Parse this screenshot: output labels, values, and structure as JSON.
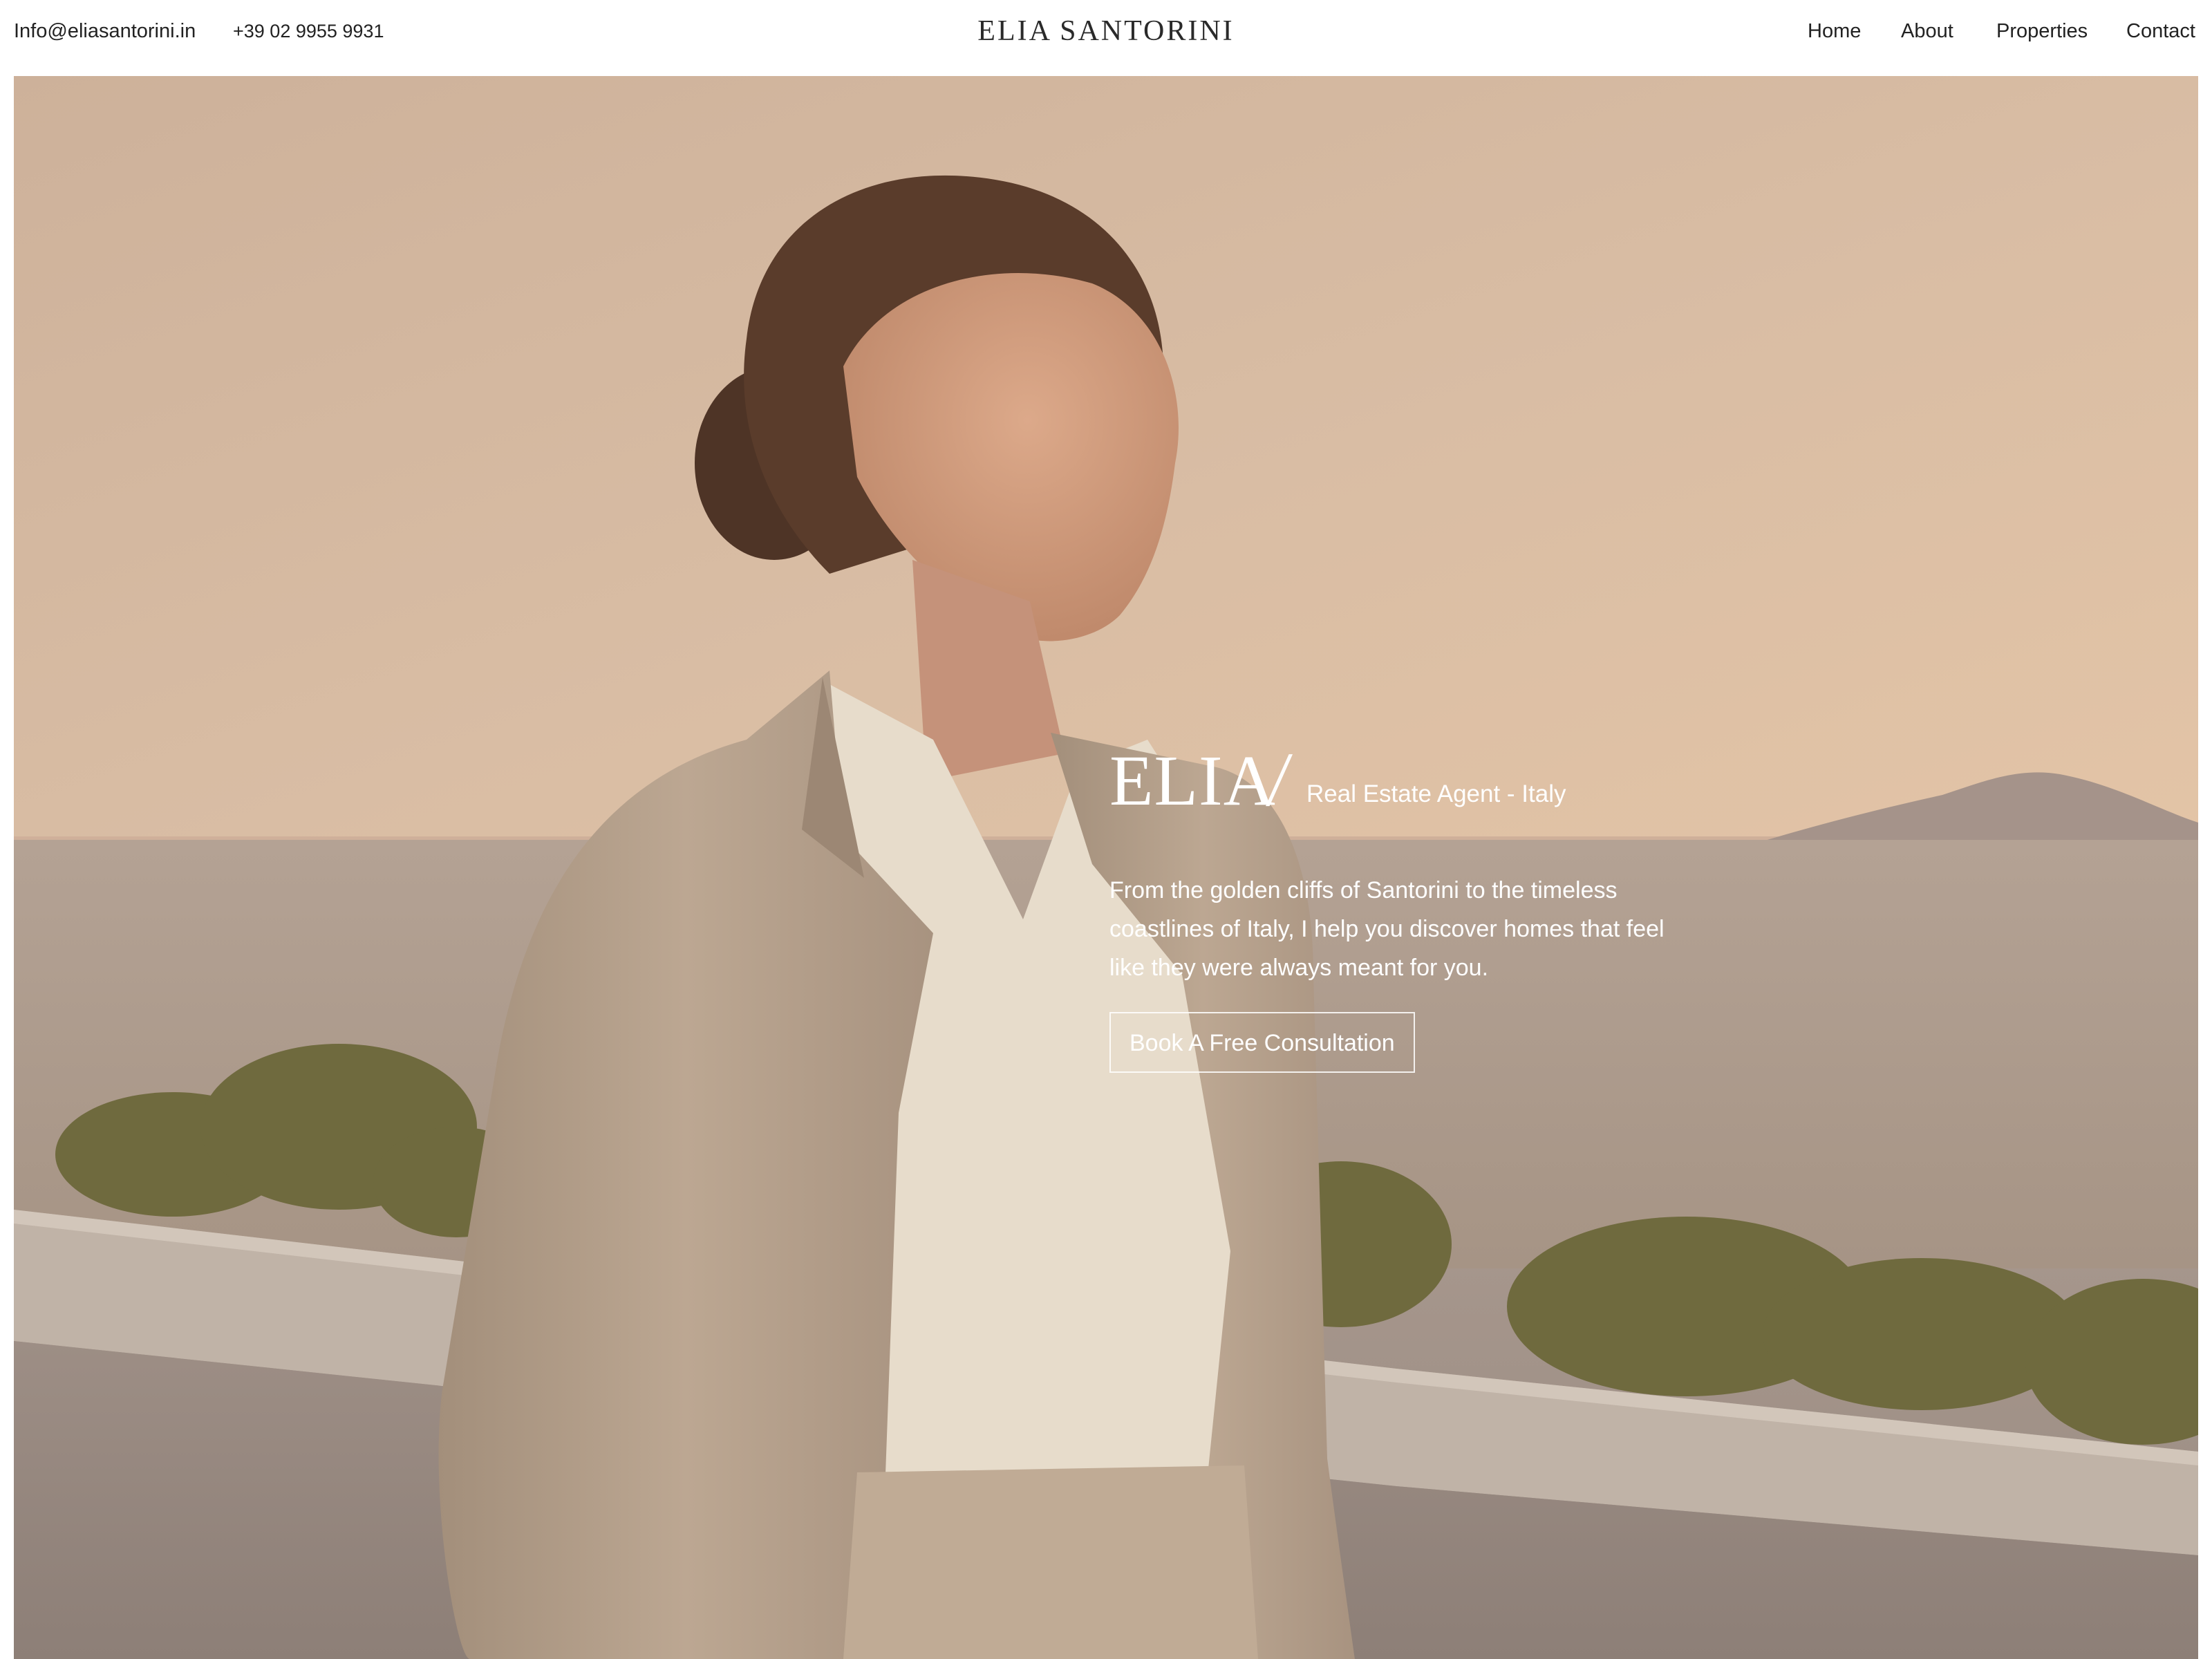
{
  "header": {
    "email": "Info@eliasantorini.in",
    "phone": "+39 02 9955 9931",
    "brand": "ELIA SANTORINI",
    "nav": [
      "Home",
      "About",
      "Properties",
      "Contact"
    ]
  },
  "hero": {
    "name": "ELIA",
    "separator": "/",
    "role": "Real Estate Agent - Italy",
    "description": "From the golden cliffs of Santorini to the timeless coastlines of Italy, I help you discover homes that feel like they were always meant for you.",
    "cta_label": "Book A Free Consultation",
    "image": "photo of a smiling woman in a beige suit on a seaside terrace at sunset"
  },
  "colors": {
    "header_background": "#ffffff",
    "hero_text": "#ffffff",
    "sky": "#d8bca3",
    "suit": "#b9a58e"
  }
}
